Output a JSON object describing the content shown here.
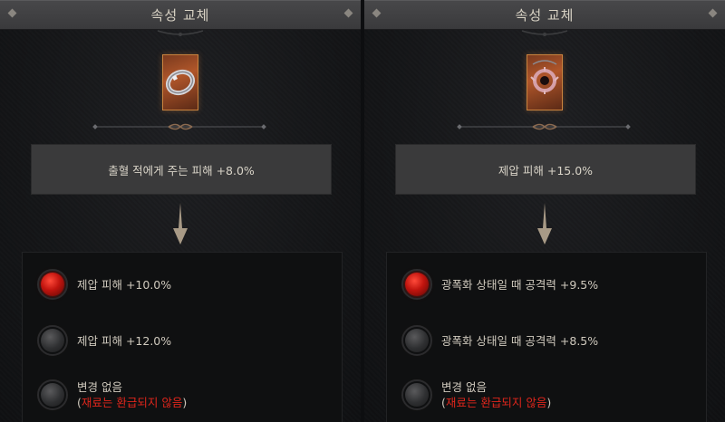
{
  "panels": [
    {
      "title": "속성 교체",
      "item_icon": "ring-icon",
      "current_stat": "출혈 적에게 주는 피해 +8.0%",
      "options": [
        {
          "text": "제압 피해 +10.0%",
          "orb": "red"
        },
        {
          "text": "제압 피해 +12.0%",
          "orb": "grey"
        },
        {
          "text": "변경 없음",
          "orb": "grey",
          "note_open": "(",
          "note_red": "재료는 환급되지 않음",
          "note_close": ")"
        }
      ]
    },
    {
      "title": "속성 교체",
      "item_icon": "amulet-icon",
      "current_stat": "제압 피해 +15.0%",
      "options": [
        {
          "text": "광폭화 상태일 때 공격력 +9.5%",
          "orb": "red"
        },
        {
          "text": "광폭화 상태일 때 공격력 +8.5%",
          "orb": "grey"
        },
        {
          "text": "변경 없음",
          "orb": "grey",
          "note_open": "(",
          "note_red": "재료는 환급되지 않음",
          "note_close": ")"
        }
      ]
    }
  ],
  "colors": {
    "title_text": "#d8d2c4",
    "item_border": "#c9833e",
    "warning": "#e0261c",
    "orb_red": "#c0140e"
  }
}
